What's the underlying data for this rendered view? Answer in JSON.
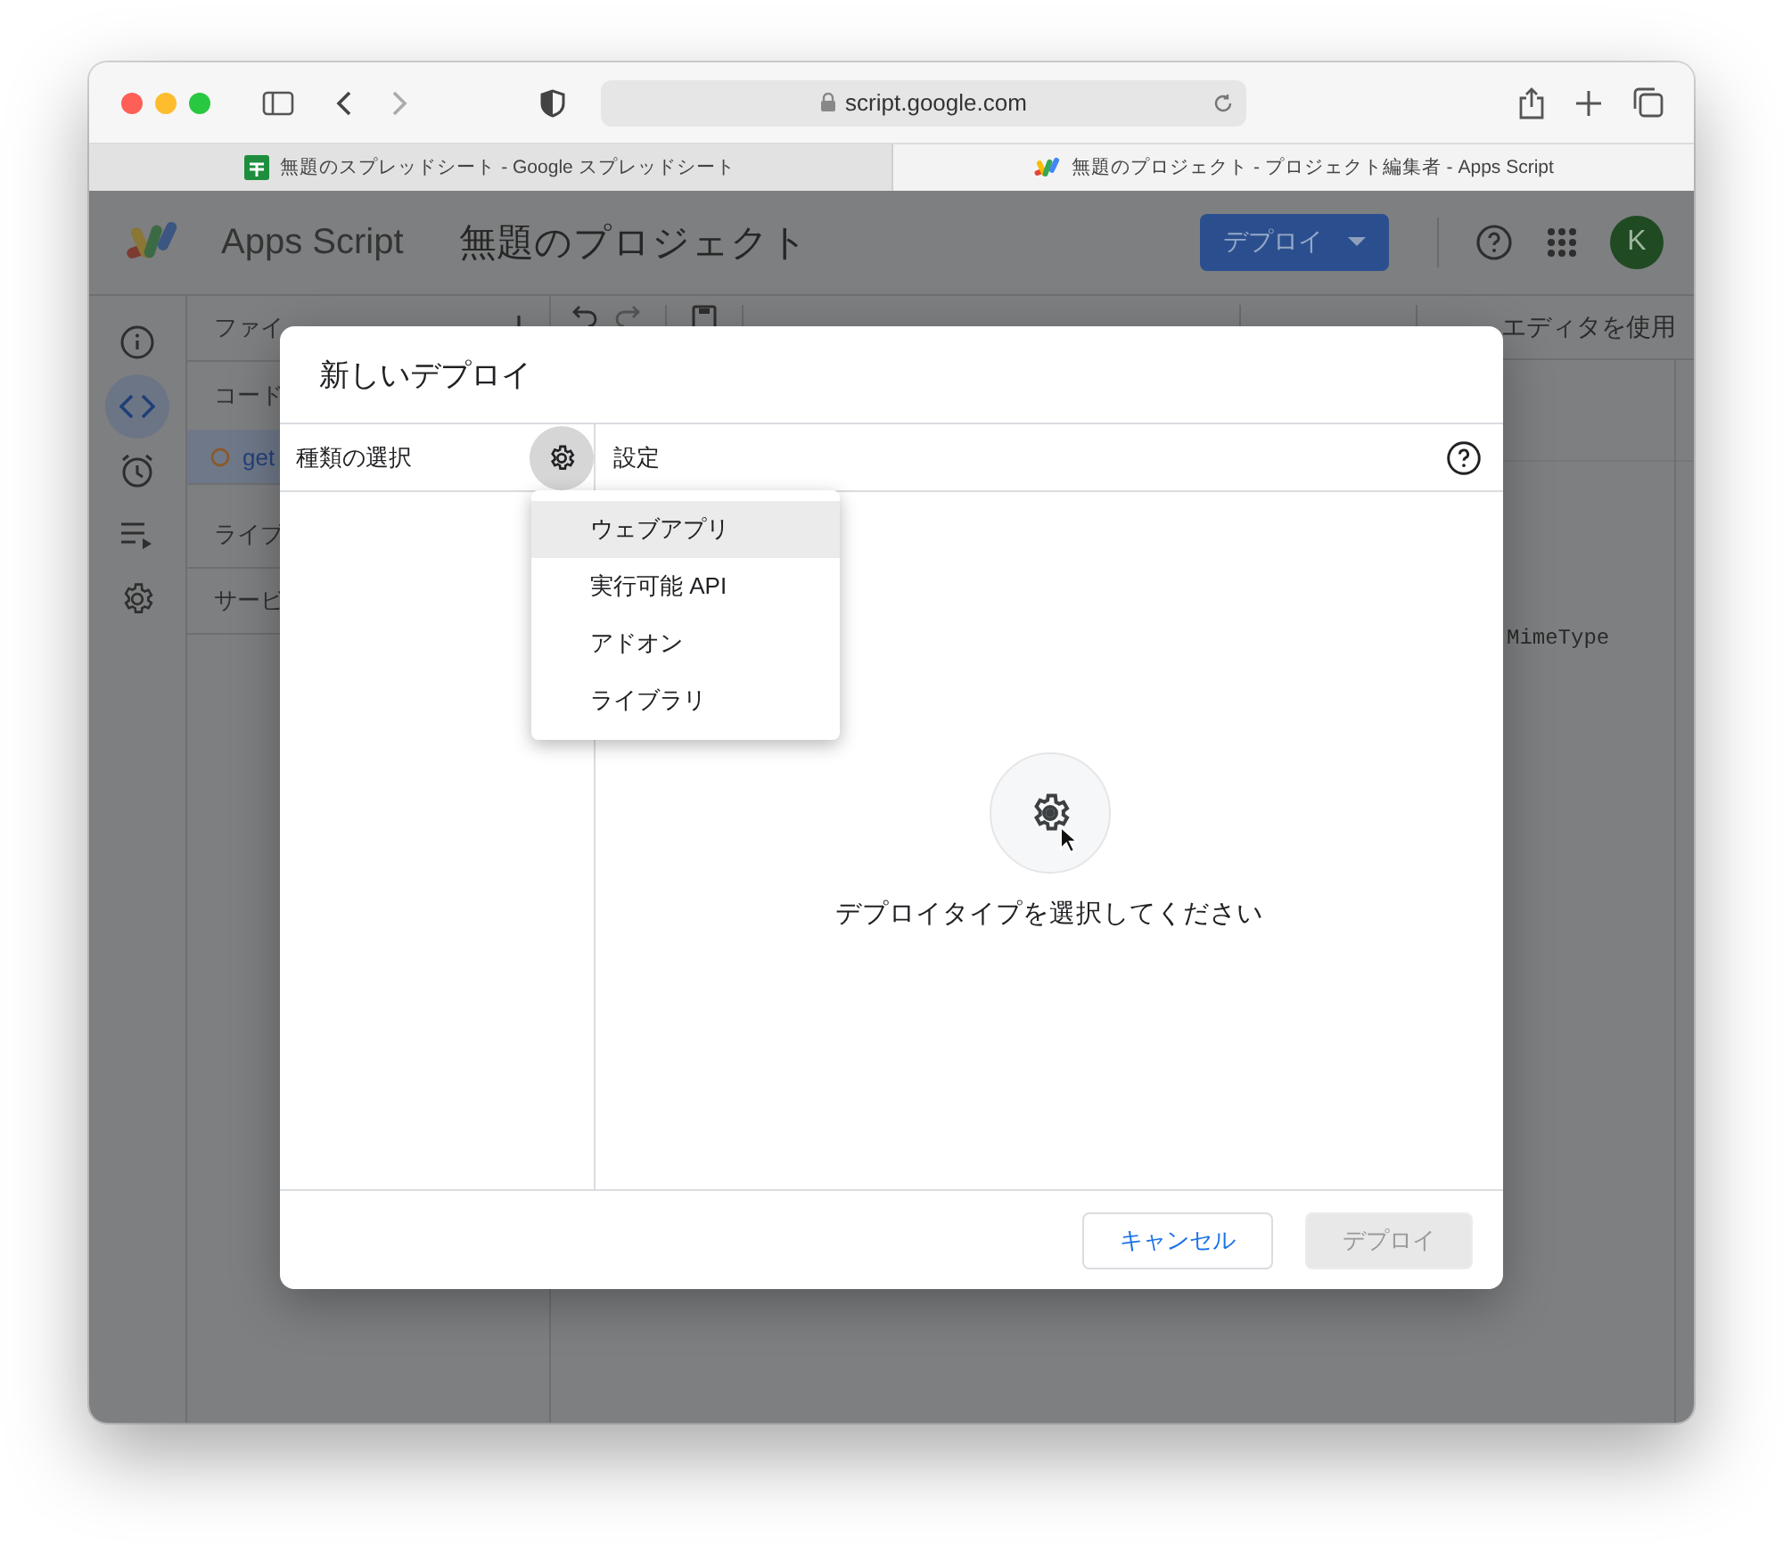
{
  "browser": {
    "url": "script.google.com",
    "tabs": [
      {
        "title": "無題のスプレッドシート - Google スプレッドシート",
        "kind": "sheets",
        "selected": false
      },
      {
        "title": "無題のプロジェクト - プロジェクト編集者 - Apps Script",
        "kind": "script",
        "selected": true
      }
    ]
  },
  "app": {
    "product": "Apps Script",
    "project_title": "無題のプロジェクト",
    "deploy_button": "デプロイ",
    "avatar": "K",
    "nav_rail": [
      {
        "kind": "info",
        "selected": false
      },
      {
        "kind": "code",
        "selected": true
      },
      {
        "kind": "triggers",
        "selected": false
      },
      {
        "kind": "executions",
        "selected": false
      },
      {
        "kind": "settings",
        "selected": false
      }
    ],
    "files_header": "ファイ",
    "files": [
      {
        "kind": "section",
        "label": "コード",
        "selected": false
      },
      {
        "kind": "file",
        "label": "get",
        "selected": true
      },
      {
        "kind": "section",
        "label": "ライブ",
        "selected": false
      },
      {
        "kind": "section",
        "label": "サービ",
        "selected": false
      }
    ],
    "toolbar": {
      "legacy": "エディタを使用"
    },
    "code_fragment": "MimeType"
  },
  "dialog": {
    "title": "新しいデプロイ",
    "type_header": "種類の選択",
    "settings_header": "設定",
    "type_menu": [
      {
        "label": "ウェブアプリ",
        "selected": true
      },
      {
        "label": "実行可能 API",
        "selected": false
      },
      {
        "label": "アドオン",
        "selected": false
      },
      {
        "label": "ライブラリ",
        "selected": false
      }
    ],
    "empty_message": "デプロイタイプを選択してください",
    "buttons": [
      {
        "label": "キャンセル",
        "disabled": false
      },
      {
        "label": "デプロイ",
        "disabled": true
      }
    ]
  }
}
